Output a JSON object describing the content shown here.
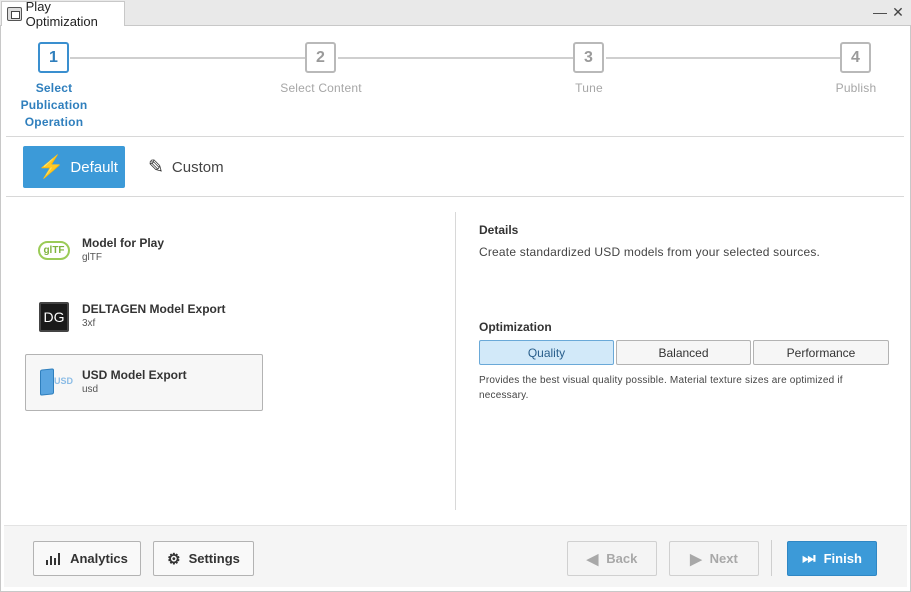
{
  "window": {
    "title": "Play Optimization",
    "minimize_glyph": "—",
    "close_glyph": "✕"
  },
  "stepper": {
    "steps": [
      {
        "number": "1",
        "label": "Select\nPublication\nOperation",
        "active": true
      },
      {
        "number": "2",
        "label": "Select Content",
        "active": false
      },
      {
        "number": "3",
        "label": "Tune",
        "active": false
      },
      {
        "number": "4",
        "label": "Publish",
        "active": false
      }
    ]
  },
  "mode": {
    "default_label": "Default",
    "custom_label": "Custom"
  },
  "operations": [
    {
      "title": "Model for Play",
      "subtitle": "glTF",
      "icon": "gltf-icon",
      "icon_text": "glTF"
    },
    {
      "title": "DELTAGEN Model Export",
      "subtitle": "3xf",
      "icon": "deltagen-icon",
      "icon_text": "DG"
    },
    {
      "title": "USD Model Export",
      "subtitle": "usd",
      "icon": "usd-icon",
      "icon_text": "USD",
      "selected": true
    }
  ],
  "details": {
    "heading": "Details",
    "text": "Create standardized USD models from your selected sources."
  },
  "optimization": {
    "heading": "Optimization",
    "options": [
      "Quality",
      "Balanced",
      "Performance"
    ],
    "selected": "Quality",
    "description": "Provides the best visual quality possible. Material texture sizes are optimized if necessary."
  },
  "footer": {
    "analytics_label": "Analytics",
    "settings_label": "Settings",
    "back_label": "Back",
    "next_label": "Next",
    "finish_label": "Finish"
  },
  "colors": {
    "accent": "#3c9ad8",
    "active_step": "#2f7fbd",
    "selected_segment": "#d2e9f9"
  }
}
